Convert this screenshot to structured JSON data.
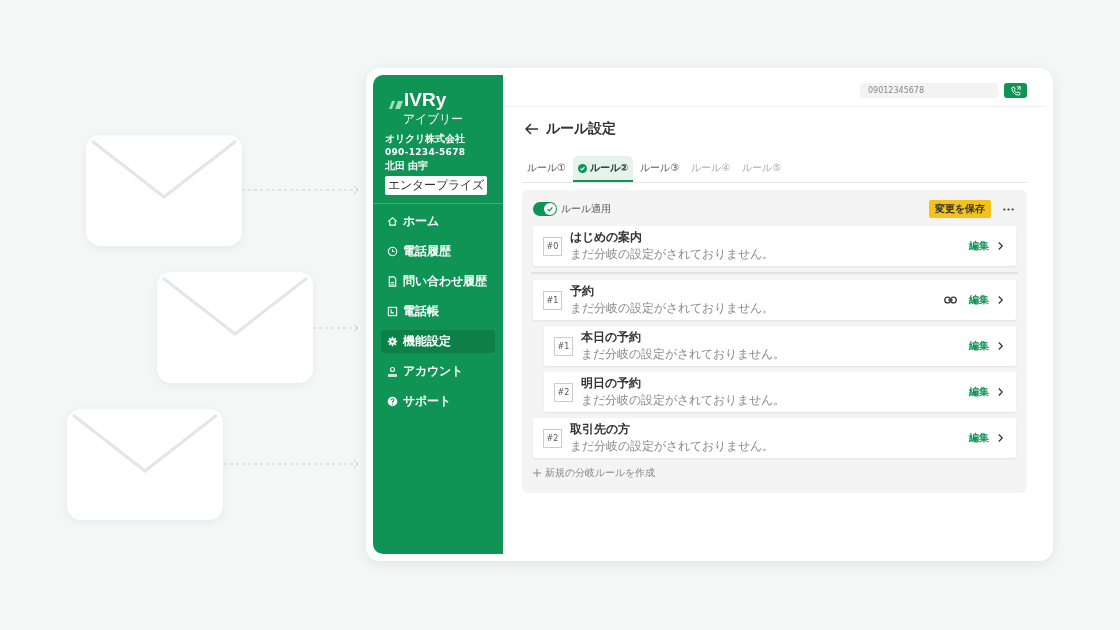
{
  "logo": {
    "name": "IVRy",
    "kana": "アイブリー"
  },
  "account": {
    "company": "オリクリ株式会社",
    "phone": "090-1234-5678",
    "user": "北田 由宇",
    "plan": "エンタープライズ"
  },
  "nav": [
    {
      "label": "ホーム",
      "selected": false
    },
    {
      "label": "電話履歴",
      "selected": false
    },
    {
      "label": "問い合わせ履歴",
      "selected": false
    },
    {
      "label": "電話帳",
      "selected": false
    },
    {
      "label": "機能設定",
      "selected": true
    },
    {
      "label": "アカウント",
      "selected": false
    },
    {
      "label": "サポート",
      "selected": false
    }
  ],
  "topbar": {
    "phone_value": "09012345678"
  },
  "page": {
    "title": "ルール設定"
  },
  "tabs": [
    {
      "label": "ルール①",
      "selected": false,
      "disabled": false
    },
    {
      "label": "ルール②",
      "selected": true,
      "disabled": false
    },
    {
      "label": "ルール③",
      "selected": false,
      "disabled": false
    },
    {
      "label": "ルール④",
      "selected": false,
      "disabled": true
    },
    {
      "label": "ルール⑤",
      "selected": false,
      "disabled": true
    }
  ],
  "toggle": {
    "label": "ルール適用",
    "on": true
  },
  "save_button": "変更を保存",
  "rules": [
    {
      "number": "#0",
      "title": "はじめの案内",
      "subtitle": "まだ分岐の設定がされておりません。",
      "edit": "編集",
      "linked": false,
      "divider_after": true
    },
    {
      "number": "#1",
      "title": "予約",
      "subtitle": "まだ分岐の設定がされておりません。",
      "edit": "編集",
      "linked": true,
      "divider_after": false,
      "children": [
        {
          "number": "#1",
          "title": "本日の予約",
          "subtitle": "まだ分岐の設定がされておりません。",
          "edit": "編集",
          "linked": false,
          "divider_after": false
        },
        {
          "number": "#2",
          "title": "明日の予約",
          "subtitle": "まだ分岐の設定がされておりません。",
          "edit": "編集",
          "linked": false,
          "divider_after": false
        }
      ]
    },
    {
      "number": "#2",
      "title": "取引先の方",
      "subtitle": "まだ分岐の設定がされておりません。",
      "edit": "編集",
      "linked": false,
      "divider_after": false
    }
  ],
  "add_rule": "新規の分岐ルールを作成"
}
